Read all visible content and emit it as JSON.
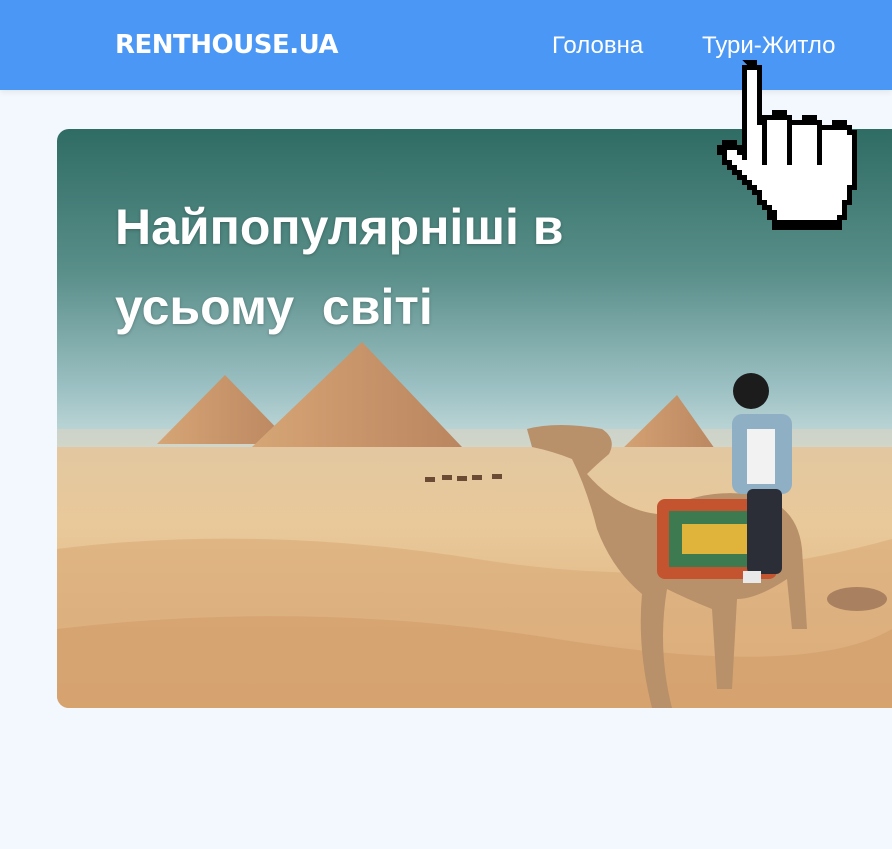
{
  "brand": "RENTHOUSE.UA",
  "nav": {
    "home": "Головна",
    "tours": "Тури-Житло"
  },
  "hero": {
    "title_line1": "Найпопулярніші в",
    "title_line2": "усьому  світі"
  },
  "colors": {
    "navbar": "#4a97f5",
    "page_bg": "#f3f8fe",
    "text": "#ffffff"
  },
  "icons": {
    "cursor": "hand-pointer-icon"
  }
}
